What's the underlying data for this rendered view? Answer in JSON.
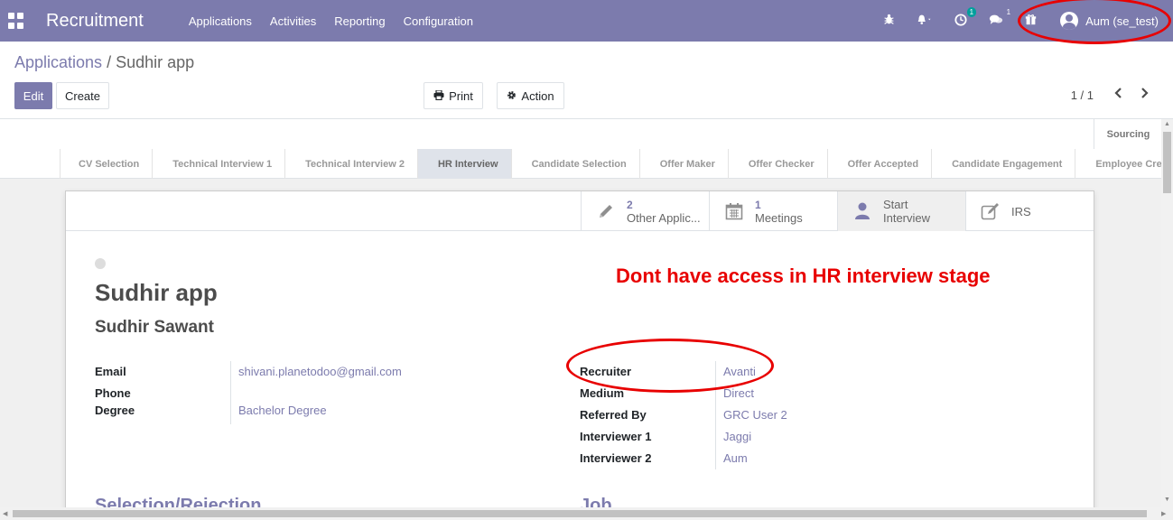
{
  "navbar": {
    "brand": "Recruitment",
    "menu": [
      "Applications",
      "Activities",
      "Reporting",
      "Configuration"
    ],
    "activity_count": "1",
    "messages_count": "1",
    "user": "Aum (se_test)"
  },
  "breadcrumb": {
    "parent": "Applications",
    "separator": "/",
    "current": "Sudhir app"
  },
  "buttons": {
    "edit": "Edit",
    "create": "Create",
    "print": "Print",
    "action": "Action"
  },
  "pager": {
    "value": "1 / 1"
  },
  "statusbar": {
    "folded": "Sourcing",
    "stages": [
      "CV Selection",
      "Technical Interview 1",
      "Technical Interview 2",
      "HR Interview",
      "Candidate Selection",
      "Offer Maker",
      "Offer Checker",
      "Offer Accepted",
      "Candidate Engagement",
      "Employee Creation"
    ],
    "active_stage": "HR Interview"
  },
  "smart_buttons": [
    {
      "num": "2",
      "label": "Other Applic...",
      "icon": "pencil-icon"
    },
    {
      "num": "1",
      "label": "Meetings",
      "icon": "calendar-icon"
    },
    {
      "num": "",
      "label": "Start Interview",
      "icon": "user-icon"
    },
    {
      "num": "",
      "label": "IRS",
      "icon": "edit-icon"
    }
  ],
  "record": {
    "name": "Sudhir app",
    "partner": "Sudhir Sawant",
    "left_fields": [
      {
        "label": "Email",
        "value": "shivani.planetodoo@gmail.com"
      },
      {
        "label": "Phone",
        "value": ""
      },
      {
        "label": "Degree",
        "value": "Bachelor Degree"
      }
    ],
    "right_fields": [
      {
        "label": "Recruiter",
        "value": "Avanti"
      },
      {
        "label": "Medium",
        "value": "Direct"
      },
      {
        "label": "Referred By",
        "value": "GRC User 2"
      },
      {
        "label": "Interviewer 1",
        "value": "Jaggi"
      },
      {
        "label": "Interviewer 2",
        "value": "Aum"
      }
    ],
    "section_left": "Selection/Rejection",
    "section_right": "Job"
  },
  "annotation": {
    "text": "Dont have access in HR interview stage",
    "color": "#e80000"
  },
  "colors": {
    "brand": "#7c7bad",
    "badge": "#00a09d"
  }
}
